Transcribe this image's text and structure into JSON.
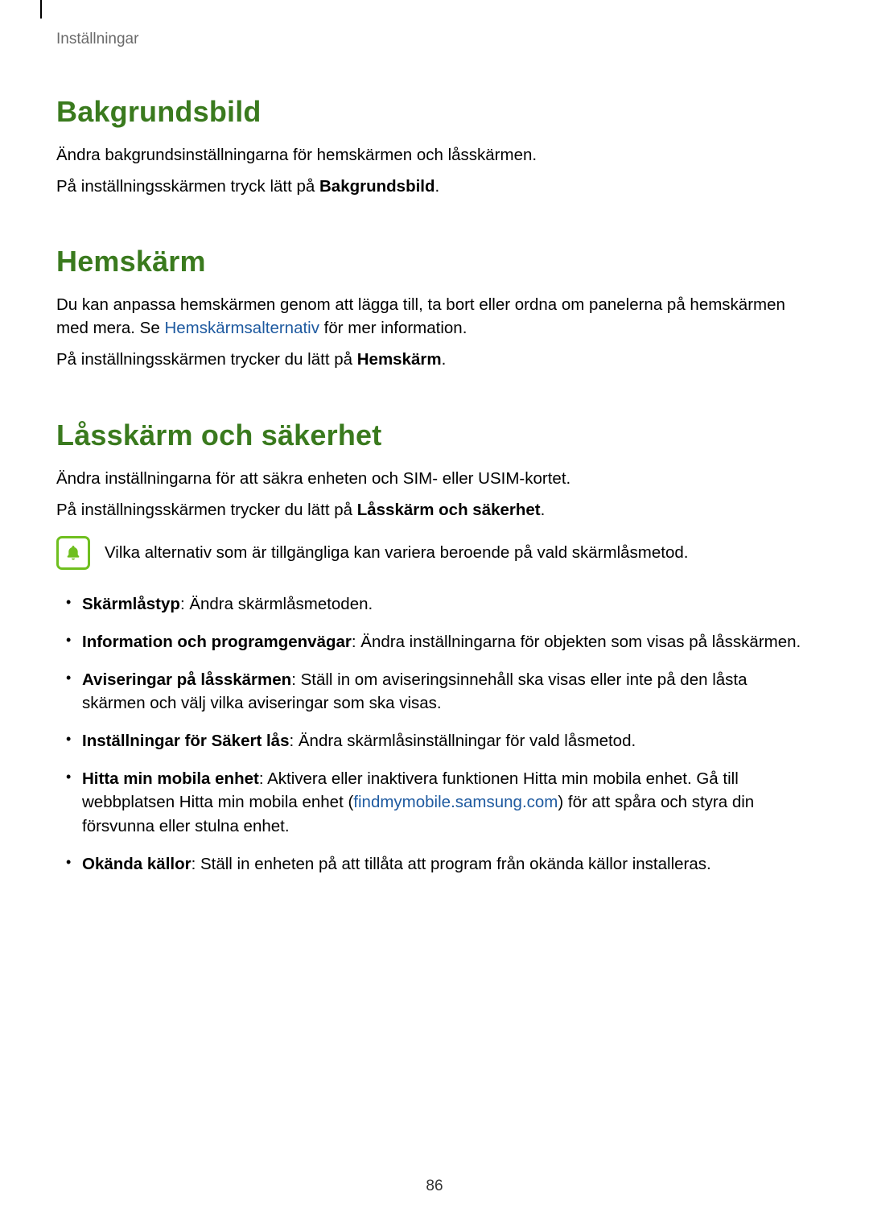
{
  "breadcrumb": "Inställningar",
  "page_number": "86",
  "sections": {
    "s1": {
      "heading": "Bakgrundsbild",
      "p1": "Ändra bakgrundsinställningarna för hemskärmen och låsskärmen.",
      "p2_pre": "På inställningsskärmen tryck lätt på ",
      "p2_bold": "Bakgrundsbild",
      "p2_post": "."
    },
    "s2": {
      "heading": "Hemskärm",
      "p1_pre": "Du kan anpassa hemskärmen genom att lägga till, ta bort eller ordna om panelerna på hemskärmen med mera. Se ",
      "p1_link": "Hemskärmsalternativ",
      "p1_post": " för mer information.",
      "p2_pre": "På inställningsskärmen trycker du lätt på ",
      "p2_bold": "Hemskärm",
      "p2_post": "."
    },
    "s3": {
      "heading": "Låsskärm och säkerhet",
      "p1": "Ändra inställningarna för att säkra enheten och SIM- eller USIM-kortet.",
      "p2_pre": "På inställningsskärmen trycker du lätt på ",
      "p2_bold": "Låsskärm och säkerhet",
      "p2_post": ".",
      "note": "Vilka alternativ som är tillgängliga kan variera beroende på vald skärmlåsmetod.",
      "bullets": {
        "b1_bold": "Skärmlåstyp",
        "b1_rest": ": Ändra skärmlåsmetoden.",
        "b2_bold": "Information och programgenvägar",
        "b2_rest": ": Ändra inställningarna för objekten som visas på låsskärmen.",
        "b3_bold": "Aviseringar på låsskärmen",
        "b3_rest": ": Ställ in om aviseringsinnehåll ska visas eller inte på den låsta skärmen och välj vilka aviseringar som ska visas.",
        "b4_bold": "Inställningar för Säkert lås",
        "b4_rest": ": Ändra skärmlåsinställningar för vald låsmetod.",
        "b5_bold": "Hitta min mobila enhet",
        "b5_pre": ": Aktivera eller inaktivera funktionen Hitta min mobila enhet. Gå till webbplatsen Hitta min mobila enhet (",
        "b5_link": "findmymobile.samsung.com",
        "b5_post": ") för att spåra och styra din försvunna eller stulna enhet.",
        "b6_bold": "Okända källor",
        "b6_rest": ": Ställ in enheten på att tillåta att program från okända källor installeras."
      }
    }
  }
}
